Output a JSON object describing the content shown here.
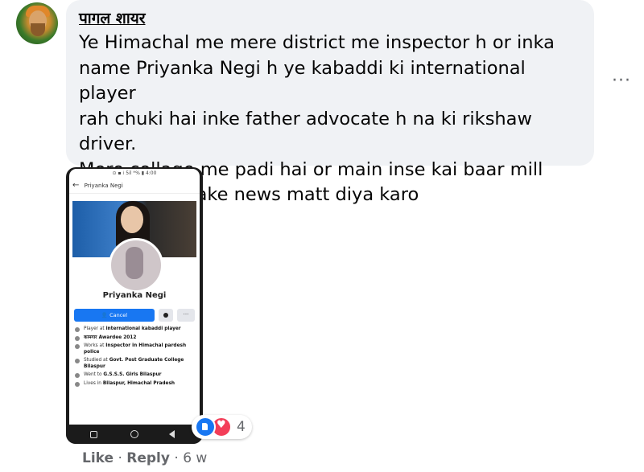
{
  "comment": {
    "author": "पागल शायर",
    "lines": [
      "Ye Himachal me mere district me inspector h or inka",
      "name Priyanka Negi h ye kabaddi ki international player",
      "rah chuki hai inke father advocate h na ki rikshaw driver.",
      "Mere collage me padi hai or main inse kai baar mill",
      "chuka hoon fake news matt diya karo"
    ],
    "more_icon": "···",
    "reaction_count": "4",
    "reaction_icons": [
      "like-icon",
      "love-icon"
    ],
    "actions": {
      "like": "Like",
      "sep1": " · ",
      "reply": "Reply",
      "sep2": " · ",
      "time": "6 w"
    }
  },
  "screenshot": {
    "status": "⊙ ▪ ⁞ 5il ᴴ% ▮ 4:00",
    "back_icon": "←",
    "app_title": "Priyanka Negi",
    "name": "Priyanka Negi",
    "cancel_button": "👤 Cancel",
    "more_button": "···",
    "info": [
      {
        "pre": "Player at ",
        "bold": "international kabaddi player"
      },
      {
        "pre": "",
        "bold": "कामगार Awardee 2012"
      },
      {
        "pre": "Works at ",
        "bold": "Inspector in Himachal pardesh police"
      },
      {
        "pre": "Studied at ",
        "bold": "Govt. Post Graduate College Bilaspur"
      },
      {
        "pre": "Went to ",
        "bold": "G.S.S.S. Girls Bilaspur"
      },
      {
        "pre": "Lives in ",
        "bold": "Bilaspur, Himachal Pradesh"
      }
    ]
  },
  "colors": {
    "bubble": "#f0f2f5",
    "text": "#050505",
    "secondary": "#65676b",
    "like_blue": "#1877f2",
    "love_red": "#f33e58"
  }
}
